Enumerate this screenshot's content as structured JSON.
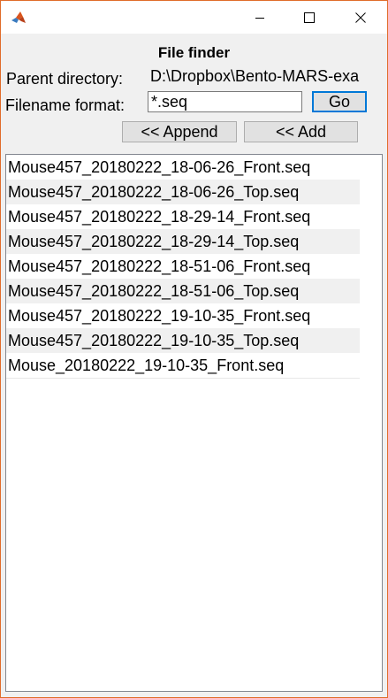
{
  "window": {
    "icon": "matlab-icon"
  },
  "form": {
    "title": "File finder",
    "parent_label": "Parent directory:",
    "parent_value": "D:\\Dropbox\\Bento-MARS-exa",
    "format_label": "Filename format:",
    "format_value": "*.seq",
    "go_label": "Go",
    "append_label": "<< Append",
    "add_label": "<< Add"
  },
  "files": [
    "Mouse457_20180222_18-06-26_Front.seq",
    "Mouse457_20180222_18-06-26_Top.seq",
    "Mouse457_20180222_18-29-14_Front.seq",
    "Mouse457_20180222_18-29-14_Top.seq",
    "Mouse457_20180222_18-51-06_Front.seq",
    "Mouse457_20180222_18-51-06_Top.seq",
    "Mouse457_20180222_19-10-35_Front.seq",
    "Mouse457_20180222_19-10-35_Top.seq",
    "Mouse_20180222_19-10-35_Front.seq"
  ],
  "colors": {
    "window_border": "#e06c2a",
    "panel_bg": "#f0f0f0",
    "row_alt_bg": "#f0f0f0",
    "go_focus": "#0078d7"
  }
}
